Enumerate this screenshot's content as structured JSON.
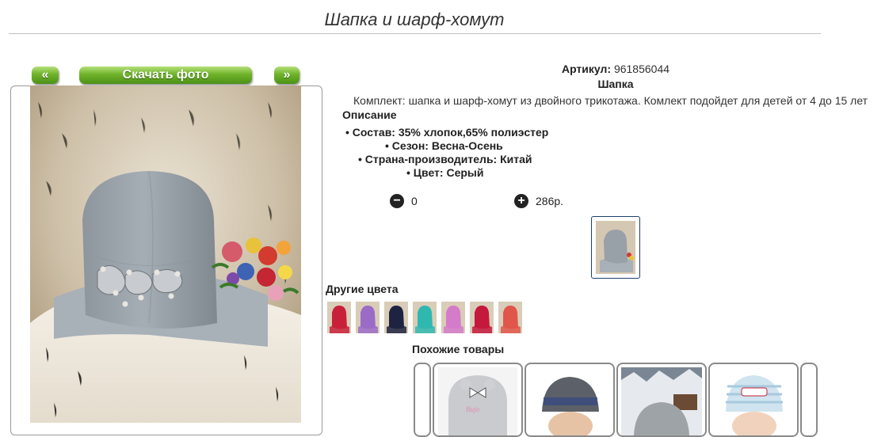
{
  "product": {
    "title": "Шапка и шарф-хомут",
    "article_label": "Артикул:",
    "article_value": "961856044",
    "category": "Шапка",
    "summary": "Комплект: шапка и шарф-хомут из двойного трикотажа. Комлект подойдет для детей от 4 до 15 лет",
    "description_heading": "Описание",
    "specs": [
      "Состав: 35% хлопок,65% полиэстер",
      "Сезон: Весна-Осень",
      "Страна-производитель: Китай",
      "Цвет: Серый"
    ],
    "quantity": "0",
    "price": "286р."
  },
  "gallery": {
    "prev_label": "«",
    "download_label": "Скачать фото",
    "next_label": "»"
  },
  "other_colors": {
    "heading": "Другие цвета",
    "swatches": [
      "#c9203a",
      "#9b6cc7",
      "#1d2340",
      "#2fb8b0",
      "#d47bc9",
      "#c4183d",
      "#e0564a"
    ]
  },
  "similar": {
    "heading": "Похожие товары"
  },
  "icons": {
    "minus": "minus-circle-icon",
    "plus": "plus-circle-icon"
  },
  "colors": {
    "button_green": "#6fb32a",
    "selected_border": "#1c3f6e"
  }
}
